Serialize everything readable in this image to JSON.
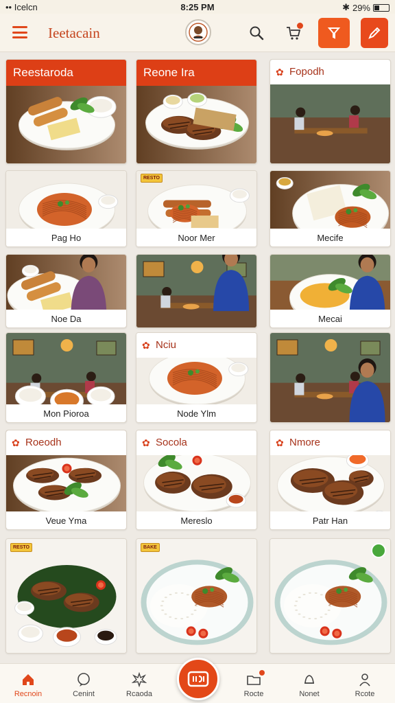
{
  "status_bar": {
    "carrier": "•• Icelcn",
    "time": "8:25 PM",
    "battery": "29%"
  },
  "header": {
    "title": "Ieetacain"
  },
  "cards": [
    {
      "label": "Reestaroda",
      "style": "banner",
      "scene": "rolls"
    },
    {
      "label": "Reone Ira",
      "style": "banner",
      "scene": "grilled"
    },
    {
      "label": "Fopodh",
      "style": "head",
      "scene": "restaurant"
    },
    {
      "label": "Pag Ho",
      "style": "caption",
      "scene": "noodle-plate"
    },
    {
      "label": "Noor Mer",
      "style": "caption",
      "scene": "noodle-sausage",
      "tag": "RESTO"
    },
    {
      "label": "Mecife",
      "style": "caption",
      "scene": "rice-noodle"
    },
    {
      "label": "Noe Da",
      "style": "caption",
      "scene": "rolls-person"
    },
    {
      "label": "",
      "style": "none",
      "scene": "restaurant-person"
    },
    {
      "label": "Mecai",
      "style": "caption",
      "scene": "fried-rice-person"
    },
    {
      "label": "Mon Pioroa",
      "style": "caption",
      "scene": "family-dining"
    },
    {
      "label": "Nciu",
      "style": "head",
      "scene": "noodle-plate",
      "caption": "Node Ylm"
    },
    {
      "label": "",
      "style": "none",
      "scene": "restaurant-person2"
    },
    {
      "label": "Roeodh",
      "style": "head",
      "scene": "grilled-fish",
      "caption": "Veue Yma"
    },
    {
      "label": "Socola",
      "style": "head",
      "scene": "grilled-chicken",
      "caption": "Mereslo"
    },
    {
      "label": "Nmore",
      "style": "head",
      "scene": "grilled-chicken2",
      "caption": "Patr Han"
    },
    {
      "label": "",
      "style": "none",
      "scene": "platter",
      "tag": "RESTO"
    },
    {
      "label": "",
      "style": "none",
      "scene": "rice-bowl",
      "tag": "BAKE"
    },
    {
      "label": "",
      "style": "none",
      "scene": "rice-bowl2",
      "badge": true
    }
  ],
  "bottom_nav": {
    "items": [
      {
        "label": "Recnoin",
        "icon": "home-icon",
        "active": true
      },
      {
        "label": "Cenint",
        "icon": "chat-icon"
      },
      {
        "label": "Rcaoda",
        "icon": "burst-icon"
      },
      {
        "label": "Rocte",
        "icon": "folder-icon",
        "badge": true
      },
      {
        "label": "Nonet",
        "icon": "bell-icon"
      },
      {
        "label": "Rcote",
        "icon": "user-icon"
      }
    ],
    "fab_icon": "scan-icon"
  },
  "colors": {
    "accent": "#e0471b",
    "banner": "#dd3f16",
    "background": "#eeeae4"
  }
}
